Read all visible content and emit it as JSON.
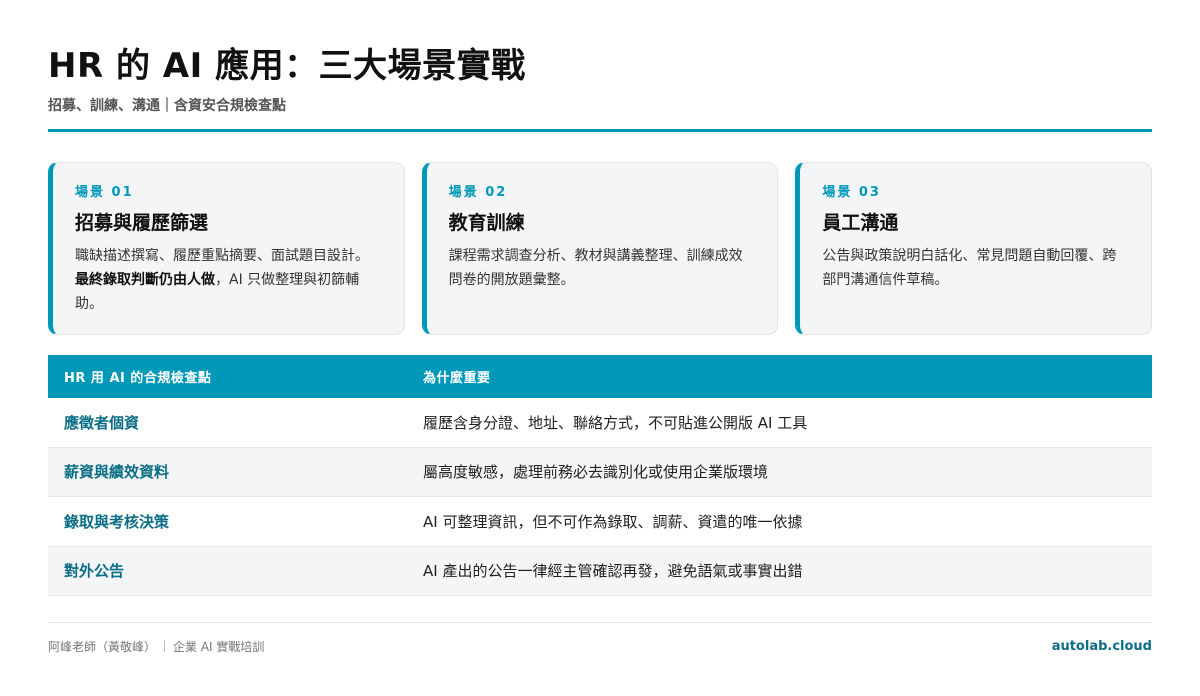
{
  "header": {
    "title": "HR 的 AI 應用：三大場景實戰",
    "subtitle": "招募、訓練、溝通｜含資安合規檢查點"
  },
  "cards": [
    {
      "tag": "場景 01",
      "title": "招募與履歷篩選",
      "desc_1": "職缺描述撰寫、履歷重點摘要、面試題目設計。",
      "desc_bold": "最終錄取判斷仍由人做",
      "desc_2": "，AI 只做整理與初篩輔助。"
    },
    {
      "tag": "場景 02",
      "title": "教育訓練",
      "desc_1": "課程需求調查分析、教材與講義整理、訓練成效問卷的開放題彙整。"
    },
    {
      "tag": "場景 03",
      "title": "員工溝通",
      "desc_1": "公告與政策說明白話化、常見問題自動回覆、跨部門溝通信件草稿。"
    }
  ],
  "table": {
    "headers": [
      "HR 用 AI 的合規檢查點",
      "為什麼重要"
    ],
    "rows": [
      {
        "key": "應徵者個資",
        "value": "履歷含身分證、地址、聯絡方式，不可貼進公開版 AI 工具"
      },
      {
        "key": "薪資與績效資料",
        "value": "屬高度敏感，處理前務必去識別化或使用企業版環境"
      },
      {
        "key": "錄取與考核決策",
        "value": "AI 可整理資訊，但不可作為錄取、調薪、資遣的唯一依據"
      },
      {
        "key": "對外公告",
        "value": "AI 產出的公告一律經主管確認再發，避免語氣或事實出錯"
      }
    ]
  },
  "footer": {
    "author": "阿峰老師（黃敬峰）",
    "course": "企業 AI 實戰培訓",
    "site": "autolab.cloud"
  },
  "colors": {
    "accent": "#0098b8",
    "accent_dark": "#0b6e86",
    "card_bg": "#f4f5f7"
  }
}
